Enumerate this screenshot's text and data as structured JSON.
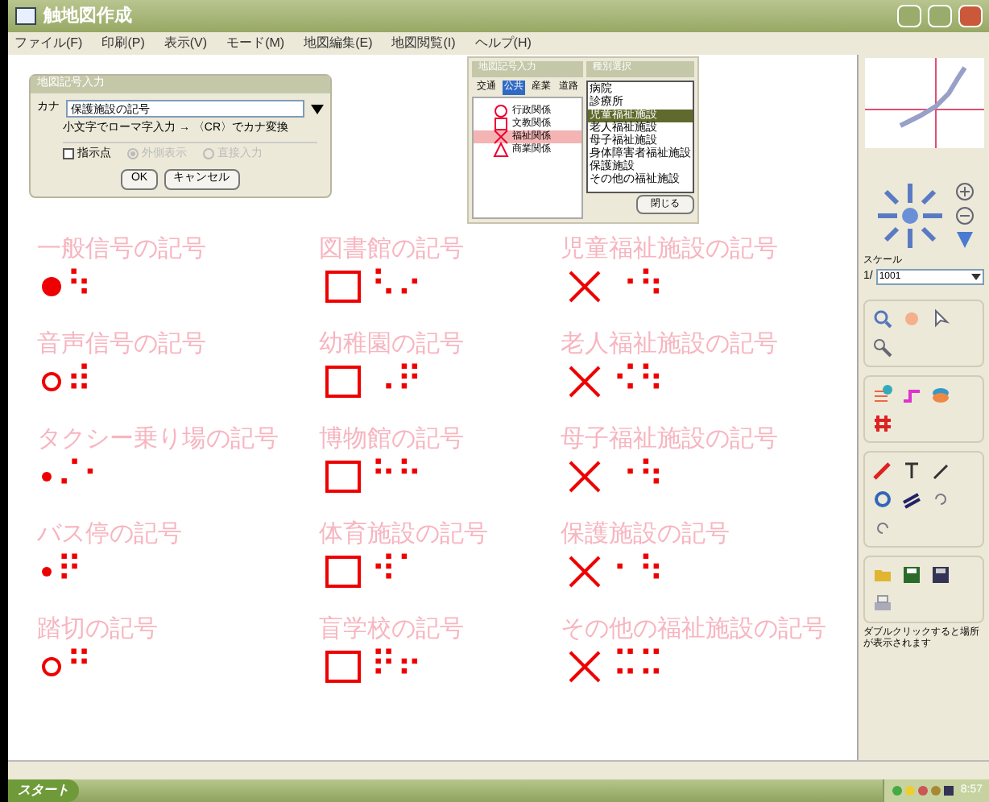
{
  "window": {
    "title": "触地図作成"
  },
  "menu": [
    "ファイル(F)",
    "印刷(P)",
    "表示(V)",
    "モード(M)",
    "地図編集(E)",
    "地図閲覧(I)",
    "ヘルプ(H)"
  ],
  "kana_dialog": {
    "title": "地図記号入力",
    "field_label": "カナ",
    "field_value": "保護施設の記号",
    "hint": "小文字でローマ字入力 → 〈CR〉でカナ変換",
    "checkbox": {
      "label": "指示点",
      "checked": false
    },
    "radios": [
      {
        "label": "外側表示",
        "selected": true,
        "disabled": true
      },
      {
        "label": "直接入力",
        "selected": false,
        "disabled": true
      }
    ],
    "buttons": [
      "OK",
      "キャンセル"
    ]
  },
  "symbol_dialog": {
    "title": "地図記号入力",
    "tabs": [
      {
        "label": "交通",
        "selected": false
      },
      {
        "label": "公共",
        "selected": true
      },
      {
        "label": "産業",
        "selected": false
      },
      {
        "label": "道路",
        "selected": false
      }
    ],
    "categories": [
      {
        "label": "行政関係",
        "kind": "circle",
        "selected": false
      },
      {
        "label": "文教関係",
        "kind": "square",
        "selected": false
      },
      {
        "label": "福祉関係",
        "kind": "cross",
        "selected": true
      },
      {
        "label": "商業関係",
        "kind": "triangle",
        "selected": false
      }
    ],
    "types_title": "種別選択",
    "types": [
      {
        "label": "病院",
        "selected": false
      },
      {
        "label": "診療所",
        "selected": false
      },
      {
        "label": "児童福祉施設",
        "selected": true
      },
      {
        "label": "老人福祉施設",
        "selected": false
      },
      {
        "label": "母子福祉施設",
        "selected": false
      },
      {
        "label": "身体障害者福祉施設",
        "selected": false
      },
      {
        "label": "保護施設",
        "selected": false
      },
      {
        "label": "その他の福祉施設",
        "selected": false
      }
    ],
    "close_button": "閉じる"
  },
  "symbols": [
    {
      "label": "一般信号の記号",
      "kind": "filled-circle",
      "braille": "⠳"
    },
    {
      "label": "図書館の記号",
      "kind": "square",
      "braille": "⠣⠔"
    },
    {
      "label": "児童福祉施設の記号",
      "kind": "cross",
      "braille": "⠐⠳"
    },
    {
      "label": "音声信号の記号",
      "kind": "open-circle",
      "braille": "⠾"
    },
    {
      "label": "幼稚園の記号",
      "kind": "square",
      "braille": "⠠⠟"
    },
    {
      "label": "老人福祉施設の記号",
      "kind": "cross",
      "braille": "⠪⠳"
    },
    {
      "label": "タクシー乗り場の記号",
      "kind": "small-dot",
      "braille": "⠌⠂"
    },
    {
      "label": "博物館の記号",
      "kind": "square",
      "braille": "⠓⠓"
    },
    {
      "label": "母子福祉施設の記号",
      "kind": "cross",
      "braille": "⠐⠳"
    },
    {
      "label": "バス停の記号",
      "kind": "small-dot",
      "braille": "⠟"
    },
    {
      "label": "体育施設の記号",
      "kind": "square",
      "braille": "⠺⠁"
    },
    {
      "label": "保護施設の記号",
      "kind": "cross",
      "braille": "⠂⠳"
    },
    {
      "label": "踏切の記号",
      "kind": "open-circle",
      "braille": "⠛"
    },
    {
      "label": "盲学校の記号",
      "kind": "square",
      "braille": "⠟⠖"
    },
    {
      "label": "その他の福祉施設の記号",
      "kind": "cross",
      "braille": "⠭⠭"
    }
  ],
  "side_panel": {
    "scale_label": "スケール",
    "scale_prefix": "1/",
    "scale_value": "1001",
    "hint": "ダブルクリックすると場所が表示されます"
  },
  "taskbar": {
    "start": "スタート",
    "clock": "8:57"
  }
}
